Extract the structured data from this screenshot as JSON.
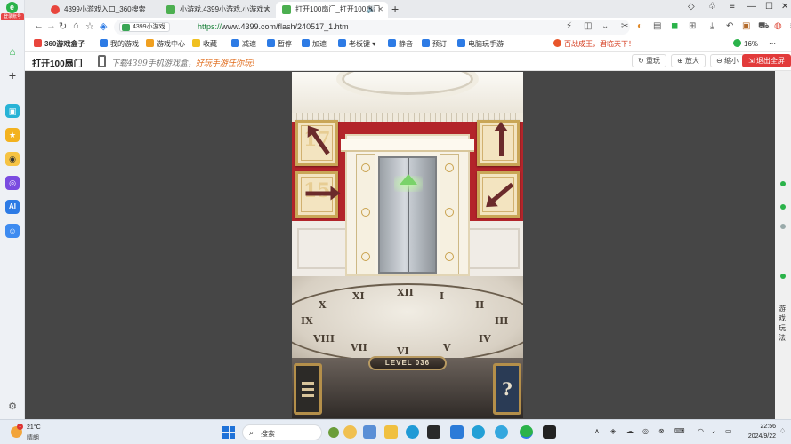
{
  "account": {
    "badge": "登录账号"
  },
  "tabs": [
    {
      "title": "4399小游戏入口_360搜索",
      "color": "#e8453c"
    },
    {
      "title": "小游戏,4399小游戏,小游戏大",
      "color": "#4caf50"
    },
    {
      "title": "打开100扇门_打开100扇门",
      "color": "#4caf50",
      "active": true
    }
  ],
  "address": {
    "site_badge": "4399小游戏",
    "scheme": "https://",
    "host_path": "www.4399.com/flash/240517_1.htm"
  },
  "bookmarks": [
    {
      "label": "360游戏盒子",
      "color": "#e8453c",
      "bold": true
    },
    {
      "label": "我的游戏",
      "color": "#2d7be5"
    },
    {
      "label": "游戏中心",
      "color": "#f0a020"
    },
    {
      "label": "收藏",
      "color": "#f0c020"
    },
    {
      "label": "减速",
      "color": "#2d7be5"
    },
    {
      "label": "暂停",
      "color": "#2d7be5"
    },
    {
      "label": "加速",
      "color": "#2d7be5"
    },
    {
      "label": "老板键",
      "color": "#2d7be5"
    },
    {
      "label": "静音",
      "color": "#2d7be5"
    },
    {
      "label": "预订",
      "color": "#2d7be5"
    },
    {
      "label": "电脑玩手游",
      "color": "#2d7be5"
    }
  ],
  "promo_right": "百战成王，君临天下！",
  "bookmark_percent": "16%",
  "gamebar": {
    "title": "打开100扇门",
    "promo_prefix": "下载4399手机游戏盒，",
    "promo_highlight": "好玩手游任你玩!",
    "reload": "重玩",
    "zoom_in": "放大",
    "zoom_out": "缩小",
    "exit_full": "退出全屏"
  },
  "right_rail": {
    "text": "游戏玩法"
  },
  "game": {
    "level": "LEVEL 036",
    "hint": "?",
    "numerals": [
      "XII",
      "I",
      "II",
      "III",
      "IX",
      "X",
      "XI",
      "VIII",
      "VII",
      "VI",
      "V",
      "IV"
    ],
    "pictures": [
      {
        "num": "17",
        "side": "left",
        "row": 0
      },
      {
        "num": "15",
        "side": "left",
        "row": 1
      },
      {
        "num": "",
        "side": "right",
        "row": 0
      },
      {
        "num": "",
        "side": "right",
        "row": 1
      }
    ]
  },
  "taskbar": {
    "temp": "21°C",
    "weather": "晴朗",
    "weather_badge": "1",
    "search_placeholder": "搜索",
    "time": "22:56",
    "date": "2024/9/22"
  }
}
